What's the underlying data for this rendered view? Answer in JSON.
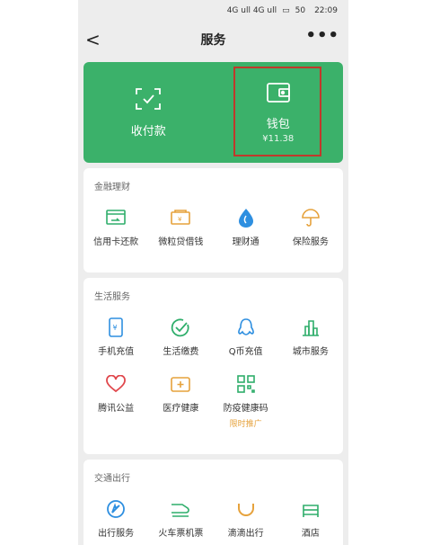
{
  "status": {
    "time": "22:09",
    "signal": "4G ull 4G ull",
    "battery": "50"
  },
  "nav": {
    "title": "服务",
    "back": "<",
    "more": "•••"
  },
  "top": {
    "pay": {
      "label": "收付款"
    },
    "wallet": {
      "label": "钱包",
      "balance": "¥11.38"
    }
  },
  "finance": {
    "title": "金融理财",
    "items": [
      {
        "label": "信用卡还款"
      },
      {
        "label": "微粒贷借钱"
      },
      {
        "label": "理财通"
      },
      {
        "label": "保险服务"
      }
    ]
  },
  "life": {
    "title": "生活服务",
    "items": [
      {
        "label": "手机充值"
      },
      {
        "label": "生活缴费"
      },
      {
        "label": "Q币充值"
      },
      {
        "label": "城市服务"
      },
      {
        "label": "腾讯公益"
      },
      {
        "label": "医疗健康"
      },
      {
        "label": "防疫健康码",
        "tag": "限时推广"
      }
    ]
  },
  "travel": {
    "title": "交通出行",
    "items": [
      {
        "label": "出行服务"
      },
      {
        "label": "火车票机票"
      },
      {
        "label": "滴滴出行"
      },
      {
        "label": "酒店"
      }
    ]
  },
  "colors": {
    "primary": "#3bb16a",
    "highlight": "#c0392b",
    "accent": "#e6a23c"
  }
}
